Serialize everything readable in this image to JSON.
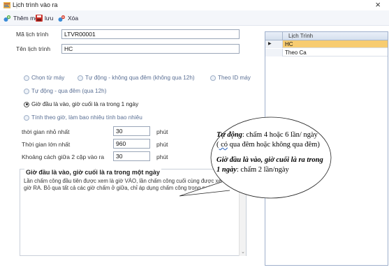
{
  "window": {
    "title": "Lịch trình vào ra",
    "close_symbol": "×"
  },
  "toolbar": {
    "add_label": "Thêm mới",
    "save_label": "lưu",
    "delete_label": "Xóa"
  },
  "form": {
    "code_label": "Mã lịch trình",
    "code_value": "LTVR00001",
    "name_label": "Tên lịch trình",
    "name_value": "HC",
    "options": [
      {
        "label": "Chọn từ máy",
        "selected": false
      },
      {
        "label": "Tự động - không qua đêm (không qua 12h)",
        "selected": false
      },
      {
        "label": "Theo ID máy",
        "selected": false
      },
      {
        "label": "Tự động - qua đêm (qua 12h)",
        "selected": false
      },
      {
        "label": "Giờ đầu là vào, giờ cuối là ra trong 1 ngày",
        "selected": true
      },
      {
        "label": "Tính theo giờ, làm bao nhiêu tính bao nhiêu",
        "selected": false
      }
    ],
    "min_time_label": "thời gian nhỏ nhất",
    "min_time_value": "30",
    "max_time_label": "Thời gian lớn nhất",
    "max_time_value": "960",
    "gap_label": "Khoảng cách giữa 2 cặp vào ra",
    "gap_value": "30",
    "unit": "phút"
  },
  "description": {
    "title": "Giờ đầu là vào, giờ cuối là ra trong một ngày",
    "text": "Lần chấm công đầu tiên được xem là giờ VÀO, lần chấm công cuối cùng được xem là giờ RA. Bỏ qua tất cả các giờ chấm ở giữa, chỉ áp dụng chấm công trong ngày."
  },
  "grid": {
    "column": "Lịch Trình",
    "rows": [
      {
        "value": "HC",
        "selected": true,
        "indicator": "▶"
      },
      {
        "value": "Theo Ca",
        "selected": false,
        "indicator": ""
      }
    ]
  },
  "annotation": {
    "p1_bold": "Tự động",
    "p1_rest": ": chấm 4 hoặc 6 lần/ ngày",
    "p1_paren_open": "(",
    "p1_underlined": " có",
    "p1_tail": " qua đêm hoặc không qua đêm)",
    "p2_bold": "Giờ đầu là vào, giờ cuối là ra trong 1 ngày",
    "p2_rest": ": chấm 2 lần/ngày"
  },
  "colors": {
    "selected_row": "#f7cc70",
    "radio_text": "#5a6f94",
    "grid_header": "#d6e0ee"
  }
}
